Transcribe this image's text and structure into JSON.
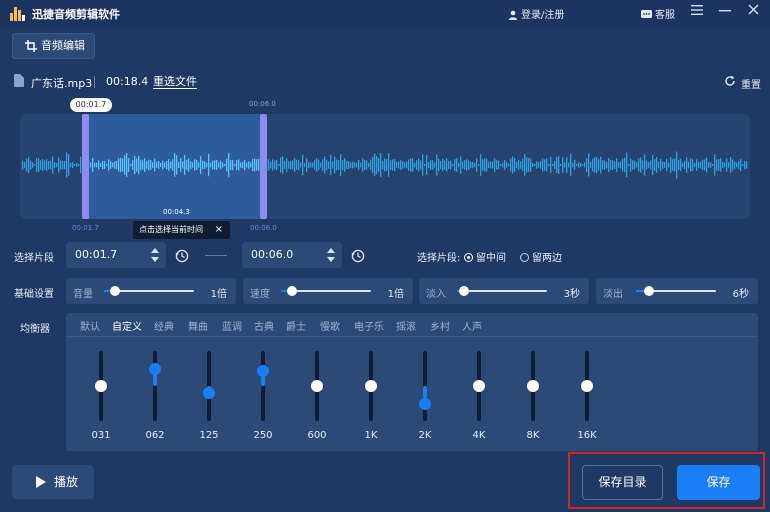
{
  "app": {
    "title": "迅捷音频剪辑软件",
    "login": "登录/注册",
    "service": "客服",
    "menu_icon": "hamburger-icon",
    "minimize_icon": "minimize-icon",
    "close_icon": "close-icon"
  },
  "toolbar": {
    "tab_label": "音频编辑"
  },
  "file": {
    "name": "广东话.mp3",
    "duration": "00:18.4",
    "reselect": "重选文件",
    "reset": "重置"
  },
  "waveform": {
    "bubble_start": "00:01.7",
    "top_end": "00:06.0",
    "bottom_start": "00:01.7",
    "bottom_end": "00:06.0",
    "selection_length": "00:04.3",
    "selection_start_fraction": 0.0924,
    "selection_end_fraction": 0.3261,
    "colors": {
      "wave": "#2f9fe0",
      "selected_wave": "#58c2ff",
      "handle": "#8f8cf0"
    }
  },
  "tooltip": {
    "text": "点击选择当前时间",
    "close": "×"
  },
  "segment": {
    "label": "选择片段",
    "start": "00:01.7",
    "end": "00:06.0",
    "mode_label": "选择片段:",
    "option_middle": "留中间",
    "option_sides": "留两边",
    "selected": "middle"
  },
  "basic": {
    "label": "基础设置",
    "volume": {
      "label": "音量",
      "value": "1倍",
      "fraction": 0.12
    },
    "speed": {
      "label": "速度",
      "value": "1倍",
      "fraction": 0.12
    },
    "fade_in": {
      "label": "淡入",
      "value": "3秒",
      "fraction": 0.08
    },
    "fade_out": {
      "label": "淡出",
      "value": "6秒",
      "fraction": 0.16
    }
  },
  "equalizer": {
    "label": "均衡器",
    "presets": [
      "默认",
      "自定义",
      "经典",
      "舞曲",
      "蓝调",
      "古典",
      "爵士",
      "慢歌",
      "电子乐",
      "摇滚",
      "乡村",
      "人声"
    ],
    "active_preset": 1,
    "bands": [
      {
        "freq": "031",
        "level": 0.5,
        "active": false
      },
      {
        "freq": "062",
        "level": 0.75,
        "active": true
      },
      {
        "freq": "125",
        "level": 0.4,
        "active": true
      },
      {
        "freq": "250",
        "level": 0.72,
        "active": true
      },
      {
        "freq": "600",
        "level": 0.5,
        "active": false
      },
      {
        "freq": "1K",
        "level": 0.5,
        "active": false
      },
      {
        "freq": "2K",
        "level": 0.24,
        "active": true
      },
      {
        "freq": "4K",
        "level": 0.5,
        "active": false
      },
      {
        "freq": "8K",
        "level": 0.5,
        "active": false
      },
      {
        "freq": "16K",
        "level": 0.5,
        "active": false
      }
    ]
  },
  "bottom": {
    "play": "播放",
    "save_dir": "保存目录",
    "save": "保存"
  },
  "colors": {
    "accent": "#1a7ff7",
    "highlight_border": "#d0252b"
  }
}
